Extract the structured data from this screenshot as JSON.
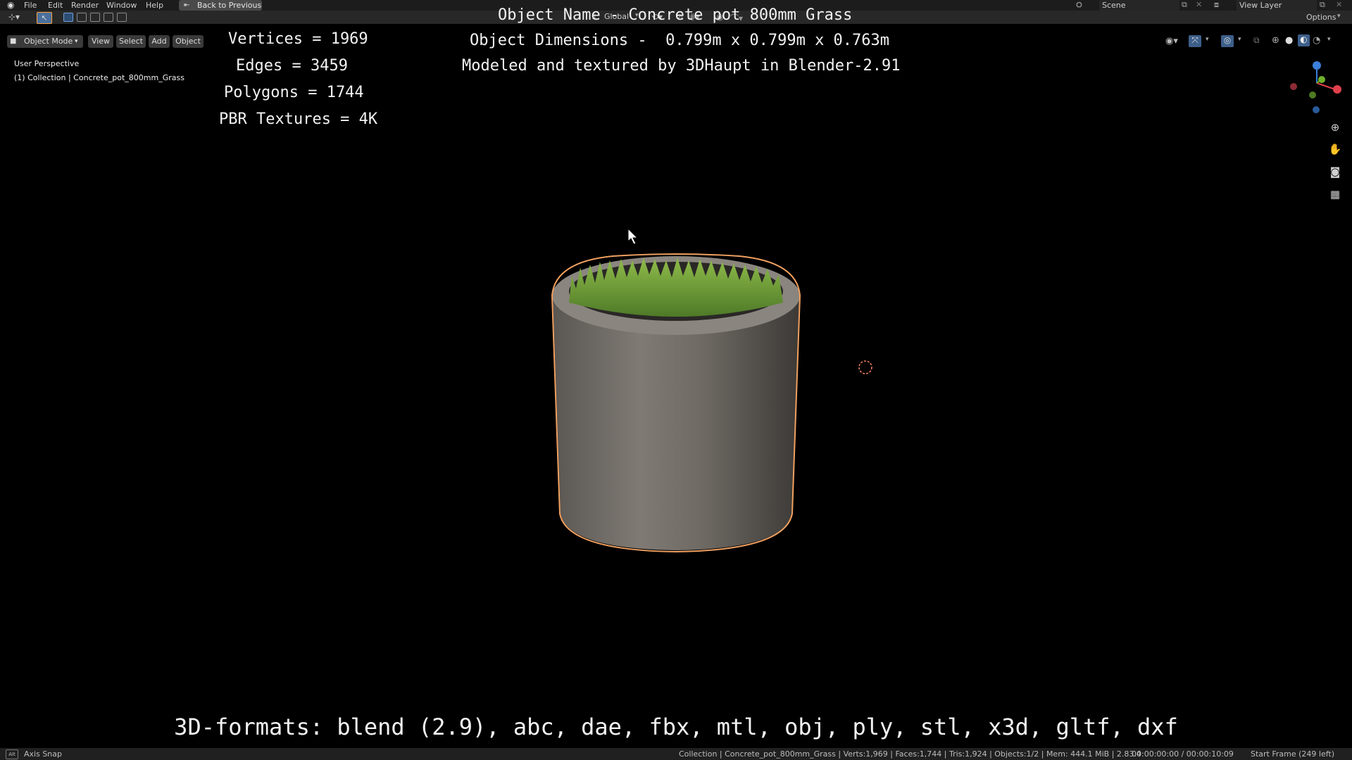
{
  "top_menu": {
    "items": [
      "File",
      "Edit",
      "Render",
      "Window",
      "Help"
    ],
    "back_button": "Back to Previous",
    "scene_label": "Scene",
    "view_layer_label": "View Layer"
  },
  "toolbar": {
    "transform_orientation": "Global",
    "options_label": "Options"
  },
  "viewport_header": {
    "mode": "Object Mode",
    "menus": [
      "View",
      "Select",
      "Add",
      "Object"
    ]
  },
  "viewport_info": {
    "perspective": "User Perspective",
    "collection": "(1) Collection | Concrete_pot_800mm_Grass"
  },
  "overlay": {
    "stats": [
      "Vertices = 1969",
      "Edges = 3459",
      "Polygons = 1744",
      "PBR Textures = 4K"
    ],
    "object_name": "Object Name - Concrete pot 800mm Grass",
    "dimensions": "Object Dimensions -  0.799m x 0.799m x 0.763m",
    "credits": "Modeled and textured by 3DHaupt in Blender-2.91",
    "formats": "3D-formats: blend (2.9), abc, dae, fbx, mtl, obj, ply, stl, x3d, gltf, dxf"
  },
  "status_bar": {
    "left_key": "Alt",
    "left_label": "Axis Snap",
    "stats": "Collection | Concrete_pot_800mm_Grass | Verts:1,969 | Faces:1,744 | Tris:1,924 | Objects:1/2 | Mem: 444.1 MiB | 2.83.4",
    "time": "00:00:00:00 / 00:00:10:09",
    "frame": "Start Frame (249 left)"
  },
  "colors": {
    "selection_outline": "#f0a060",
    "axis_x": "#e0404c",
    "axis_y": "#6fb02a",
    "axis_z": "#3a7fd8",
    "grass": "#6f9a3a",
    "concrete": "#7a7570"
  }
}
